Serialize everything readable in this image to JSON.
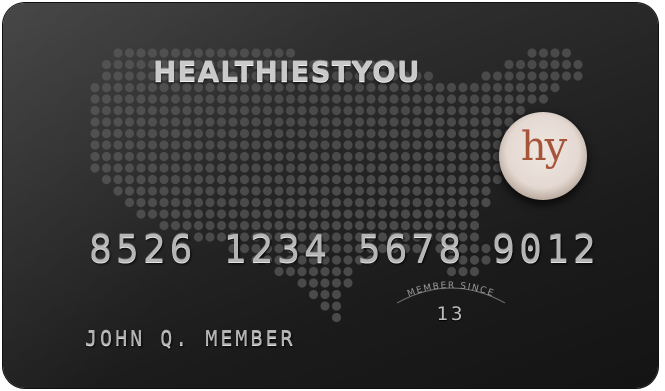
{
  "card": {
    "brand": "HEALTHIESTYOU",
    "logo_text": "hy",
    "number": "8526 1234 5678 9012",
    "member_since_label": "MEMBER SINCE",
    "member_since_year": "13",
    "cardholder_name": "JOHN Q. MEMBER"
  },
  "colors": {
    "card_background": "#2a2a2a",
    "dot": "#4a4a4a",
    "embossed_text": "#b5b5b5",
    "logo_accent": "#a6553b"
  },
  "icons": {
    "background_map": "usa-dot-map",
    "logo": "hy-badge"
  }
}
